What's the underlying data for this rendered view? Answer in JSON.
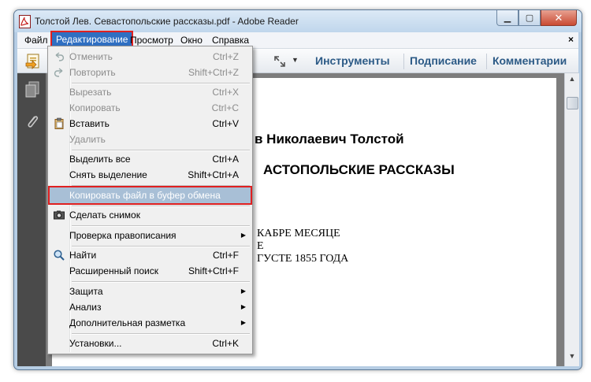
{
  "window": {
    "title": "Толстой Лев. Севастопольские рассказы.pdf - Adobe Reader",
    "controls": {
      "minimize": "▁",
      "maximize": "▢",
      "close": "✕"
    }
  },
  "menubar": {
    "items": [
      "Файл",
      "Редактирование",
      "Просмотр",
      "Окно",
      "Справка"
    ],
    "active": "Редактирование",
    "close_symbol": "×"
  },
  "toolbar": {
    "links": [
      "Инструменты",
      "Подписание",
      "Комментарии"
    ],
    "fit_icon": "expand-arrows-icon",
    "dropdown_symbol": "▼"
  },
  "document": {
    "author": "в Николаевич Толстой",
    "title": "АСТОПОЛЬСКИЕ РАССКАЗЫ",
    "lines": [
      "КАБРЕ МЕСЯЦЕ",
      "Е",
      "ГУСТЕ 1855 ГОДА"
    ]
  },
  "edit_menu": {
    "items": [
      {
        "label": "Отменить",
        "shortcut": "Ctrl+Z",
        "enabled": false,
        "icon": "undo-icon"
      },
      {
        "label": "Повторить",
        "shortcut": "Shift+Ctrl+Z",
        "enabled": false,
        "icon": "redo-icon"
      },
      {
        "label": "Вырезать",
        "shortcut": "Ctrl+X",
        "enabled": false
      },
      {
        "label": "Копировать",
        "shortcut": "Ctrl+C",
        "enabled": false
      },
      {
        "label": "Вставить",
        "shortcut": "Ctrl+V",
        "enabled": true,
        "icon": "paste-icon"
      },
      {
        "label": "Удалить",
        "shortcut": "",
        "enabled": false
      },
      {
        "label": "Выделить все",
        "shortcut": "Ctrl+A",
        "enabled": true
      },
      {
        "label": "Снять выделение",
        "shortcut": "Shift+Ctrl+A",
        "enabled": true
      },
      {
        "label": "Копировать файл в буфер обмена",
        "shortcut": "",
        "enabled": true,
        "highlighted": true
      },
      {
        "label": "Сделать снимок",
        "shortcut": "",
        "enabled": true,
        "icon": "camera-icon"
      },
      {
        "label": "Проверка правописания",
        "shortcut": "",
        "enabled": true,
        "submenu": true
      },
      {
        "label": "Найти",
        "shortcut": "Ctrl+F",
        "enabled": true,
        "icon": "search-icon"
      },
      {
        "label": "Расширенный поиск",
        "shortcut": "Shift+Ctrl+F",
        "enabled": true
      },
      {
        "label": "Защита",
        "shortcut": "",
        "enabled": true,
        "submenu": true
      },
      {
        "label": "Анализ",
        "shortcut": "",
        "enabled": true,
        "submenu": true
      },
      {
        "label": "Дополнительная разметка",
        "shortcut": "",
        "enabled": true,
        "submenu": true
      },
      {
        "label": "Установки...",
        "shortcut": "Ctrl+K",
        "enabled": true
      }
    ],
    "submenu_arrow": "▶"
  },
  "colors": {
    "menu_active_bg": "#2f6fc2",
    "highlight_outline": "#e02020",
    "toolbar_link": "#2c5a86",
    "item_highlight_bg": "#a8bfd6"
  }
}
